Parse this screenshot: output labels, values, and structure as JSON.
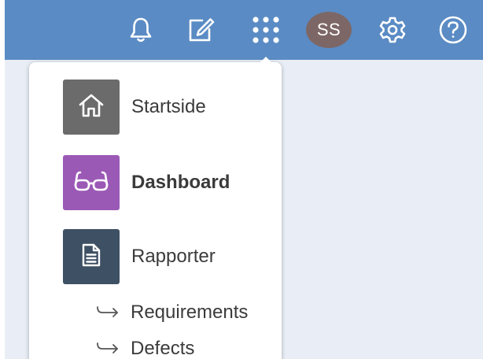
{
  "header": {
    "bar_color": "#5a8bc4",
    "icons": [
      {
        "name": "bell-icon"
      },
      {
        "name": "edit-icon"
      },
      {
        "name": "apps-grid-icon"
      },
      {
        "name": "settings-gear-icon"
      },
      {
        "name": "help-icon"
      }
    ],
    "avatar_initials": "SS",
    "avatar_color": "#7d6766"
  },
  "menu": {
    "items": [
      {
        "label": "Startside",
        "icon": "home-icon",
        "tile_color": "#6b6b6b"
      },
      {
        "label": "Dashboard",
        "icon": "glasses-icon",
        "tile_color": "#9b59b6"
      },
      {
        "label": "Rapporter",
        "icon": "document-icon",
        "tile_color": "#3e5064"
      }
    ],
    "sub_items": [
      {
        "label": "Requirements",
        "icon": "return-arrow-icon"
      },
      {
        "label": "Defects",
        "icon": "return-arrow-icon"
      }
    ]
  }
}
